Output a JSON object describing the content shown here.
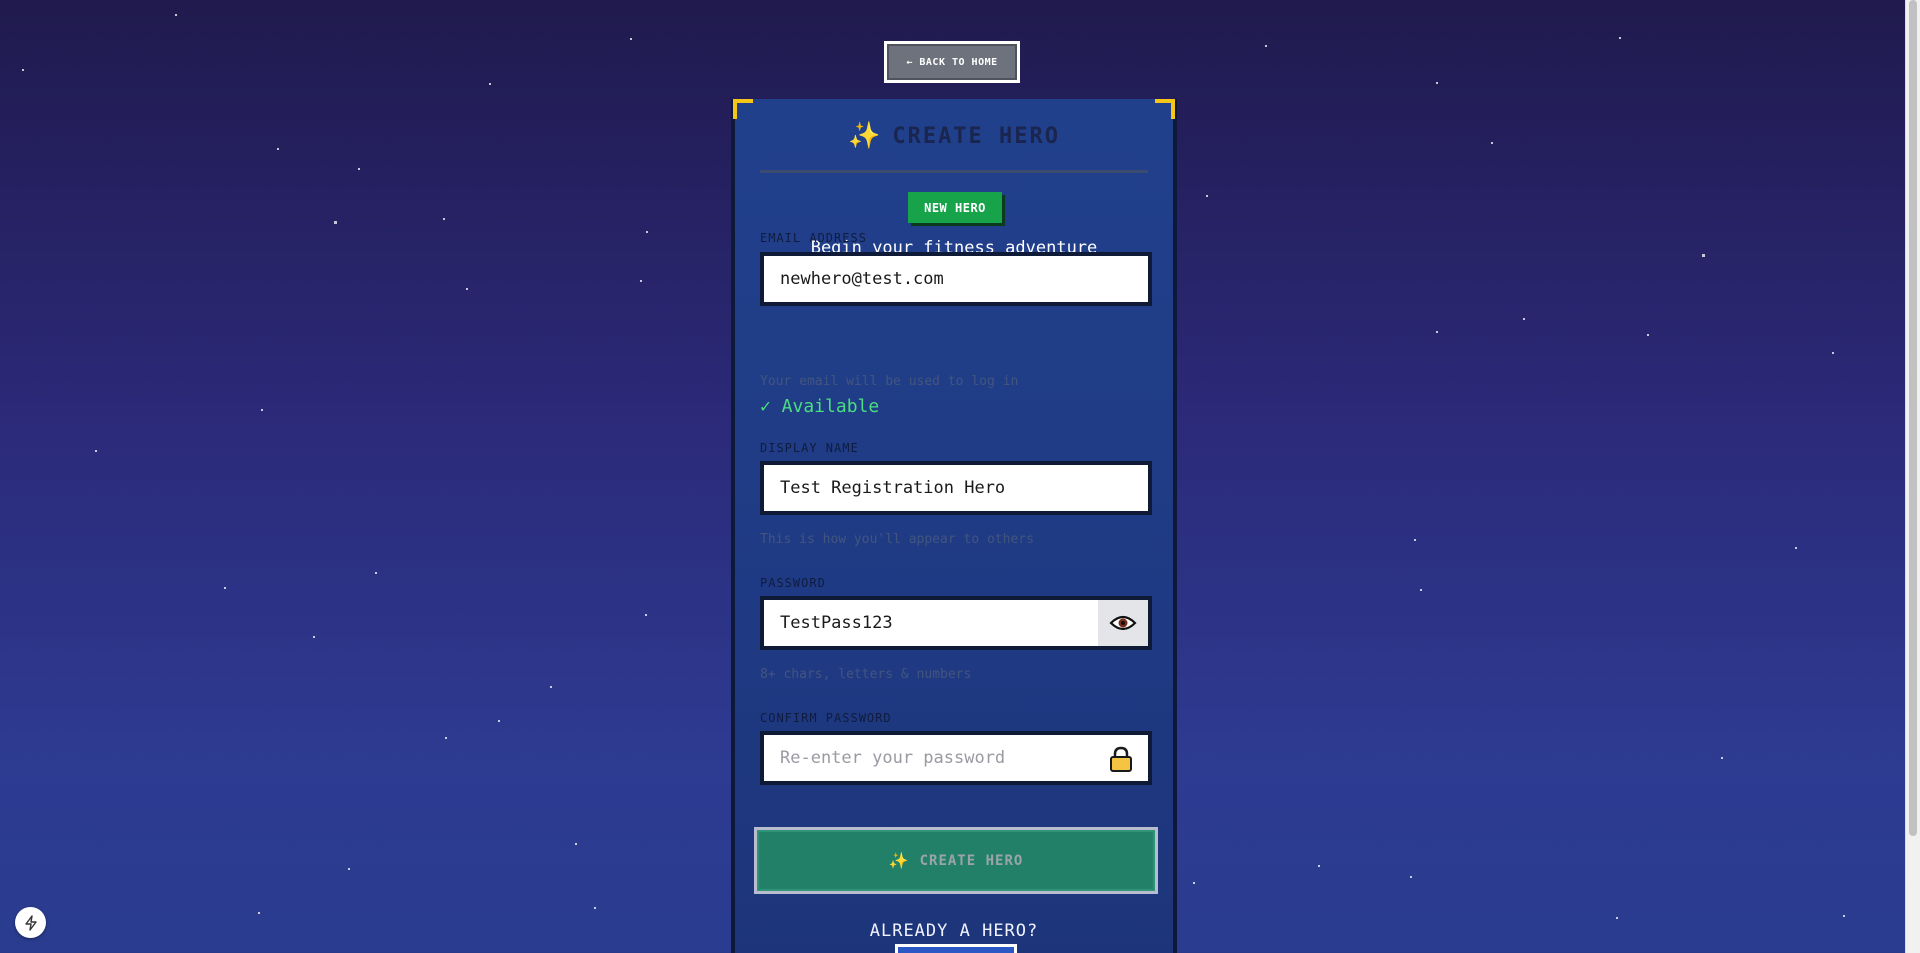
{
  "nav": {
    "back_label": "← BACK TO HOME"
  },
  "card": {
    "title": "CREATE HERO",
    "title_icon": "sparkles-icon",
    "badge": "NEW HERO",
    "subtitle": "Begin your fitness adventure"
  },
  "form": {
    "email": {
      "label": "EMAIL ADDRESS",
      "value": "newhero@test.com",
      "hint": "Your email will be used to log in",
      "status": "✓ Available"
    },
    "display_name": {
      "label": "DISPLAY NAME",
      "value": "Test Registration Hero",
      "hint": "This is how you'll appear to others"
    },
    "password": {
      "label": "PASSWORD",
      "value": "TestPass123",
      "hint": "8+ chars, letters & numbers",
      "toggle_icon": "eye-icon"
    },
    "confirm_password": {
      "label": "CONFIRM PASSWORD",
      "value": "",
      "placeholder": "Re-enter your password",
      "icon": "lock-icon"
    },
    "submit_label": "CREATE HERO"
  },
  "footer": {
    "already_label": "ALREADY A HERO?"
  },
  "colors": {
    "badge_green": "#16a34a",
    "available_green": "#4ade80",
    "accent_gold": "#f5c518",
    "submit_teal": "#238068"
  }
}
